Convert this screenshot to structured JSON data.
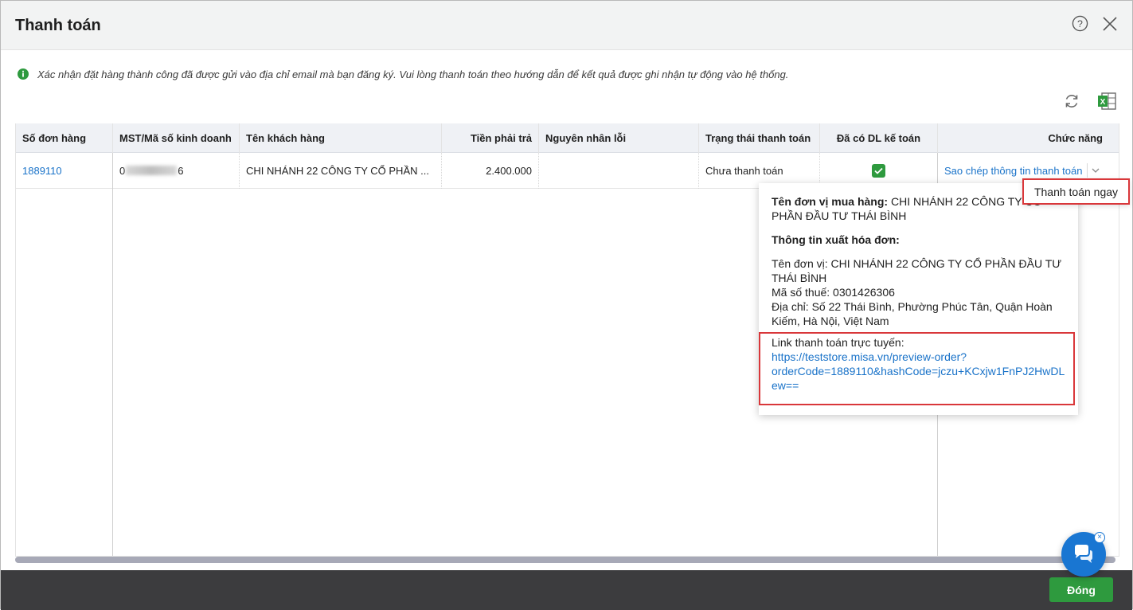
{
  "dialog": {
    "title": "Thanh toán",
    "notice": "Xác nhận đặt hàng thành công đã được gửi vào địa chỉ email mà bạn đăng ký. Vui lòng thanh toán theo hướng dẫn để kết quả được ghi nhận tự động vào hệ thống."
  },
  "table": {
    "columns": {
      "order_no": "Số đơn hàng",
      "tax_code": "MST/Mã số kinh doanh",
      "customer": "Tên khách hàng",
      "amount": "Tiền phải trả",
      "error_reason": "Nguyên nhân lỗi",
      "payment_status": "Trạng thái thanh toán",
      "accounting_data": "Đã có DL kế toán",
      "function": "Chức năng"
    },
    "rows": [
      {
        "order_no": "1889110",
        "tax_code_prefix": "0",
        "tax_code_suffix": "6",
        "customer": "CHI NHÁNH 22 CÔNG TY CỔ PHẦN ...",
        "amount": "2.400.000",
        "error_reason": "",
        "payment_status": "Chưa thanh toán",
        "accounting_data_checked": true,
        "function_link": "Sao chép thông tin thanh toán"
      }
    ]
  },
  "dropdown_menu": {
    "items": [
      "Thanh toán ngay"
    ]
  },
  "payment_info": {
    "buyer_label": "Tên đơn vị mua hàng:",
    "buyer_value": "CHI NHÁNH 22 CÔNG TY CỔ PHẦN ĐẦU TƯ THÁI BÌNH",
    "invoice_heading": "Thông tin xuất hóa đơn:",
    "unit_line_1": "Tên đơn vị: CHI NHÁNH 22 CÔNG TY CỔ PHẦN ĐẦU TƯ",
    "unit_line_2": "THÁI BÌNH",
    "tax_code_line": "Mã số thuế: 0301426306",
    "address_line_1": "Địa chỉ: Số 22 Thái Bình, Phường Phúc Tân, Quận Hoàn",
    "address_line_2": "Kiếm, Hà Nội, Việt Nam",
    "online_link_label": "Link thanh toán trực tuyến:",
    "online_link_line_1": "https://teststore.misa.vn/preview-order?",
    "online_link_line_2": "orderCode=1889110&hashCode=jczu+KCxjw1FnPJ2HwDL",
    "online_link_line_3": "ew=="
  },
  "footer": {
    "close_label": "Đóng"
  },
  "colors": {
    "accent_green": "#2e9a3e",
    "link_blue": "#1a73c9",
    "highlight_red": "#d9373a",
    "footer_dark": "#3c3c3e",
    "chat_blue": "#1976d2"
  },
  "icons": [
    "help-icon",
    "close-icon",
    "info-icon",
    "reload-icon",
    "excel-icon",
    "checkbox-checked-icon",
    "chevron-down-icon",
    "chat-icon"
  ]
}
